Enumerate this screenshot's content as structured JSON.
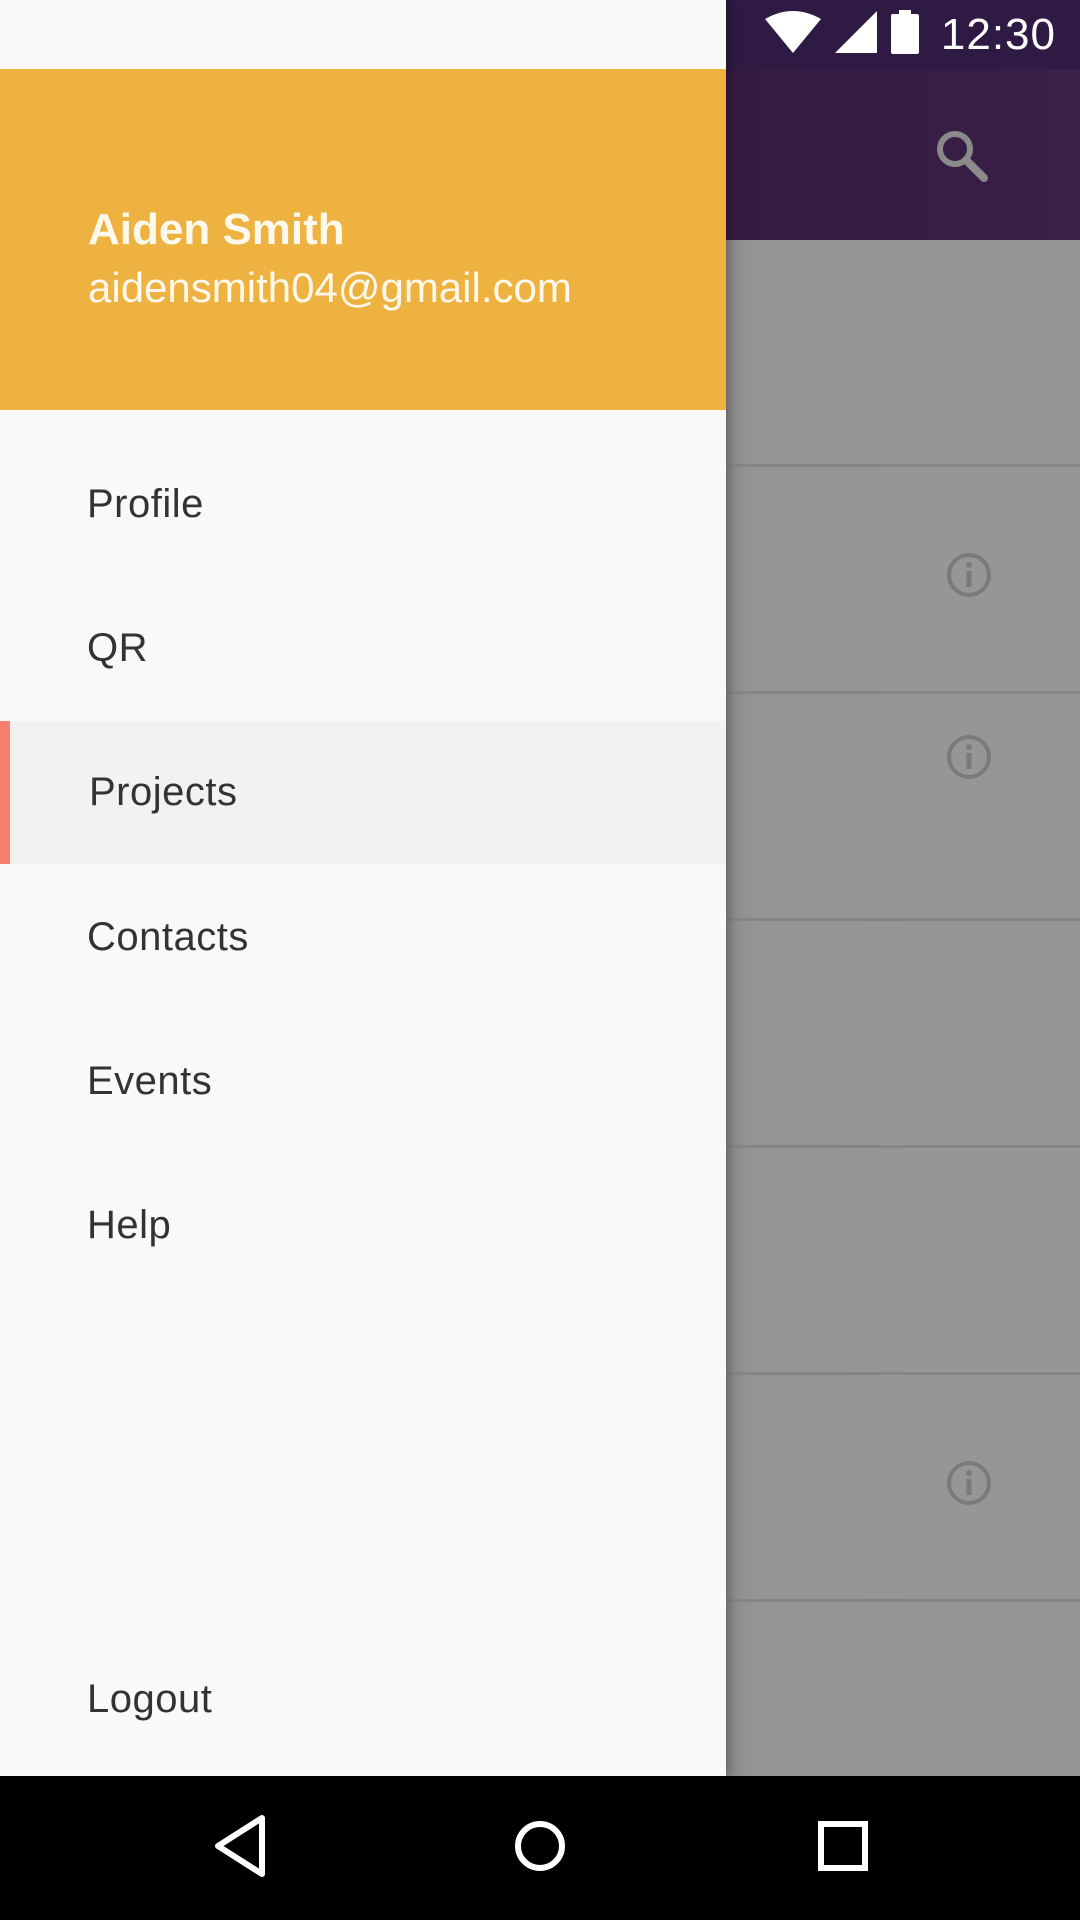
{
  "status_bar": {
    "time": "12:30",
    "icons": [
      "wifi-icon",
      "cell-signal-icon",
      "battery-icon"
    ],
    "drawer_tint_color": "#c09033",
    "color": "#2e1a42"
  },
  "app_bar": {
    "color": "#3a1f47",
    "actions": [
      "search-icon"
    ]
  },
  "list": {
    "rows": [
      {
        "has_info_icon": false
      },
      {
        "has_info_icon": true
      },
      {
        "has_info_icon": true
      },
      {
        "has_info_icon": false
      },
      {
        "has_info_icon": false
      },
      {
        "has_info_icon": true
      },
      {
        "has_info_icon": false
      }
    ]
  },
  "drawer": {
    "header_color": "#eeb240",
    "user": {
      "name": "Aiden Smith",
      "email": "aidensmith04@gmail.com"
    },
    "items": [
      {
        "label": "Profile",
        "active": false
      },
      {
        "label": "QR",
        "active": false
      },
      {
        "label": "Projects",
        "active": true
      },
      {
        "label": "Contacts",
        "active": false
      },
      {
        "label": "Events",
        "active": false
      },
      {
        "label": "Help",
        "active": false
      }
    ],
    "footer_item": {
      "label": "Logout"
    },
    "active_indicator_color": "#f47f6d"
  },
  "system_nav": {
    "buttons": [
      "back-icon",
      "home-icon",
      "recents-icon"
    ]
  }
}
